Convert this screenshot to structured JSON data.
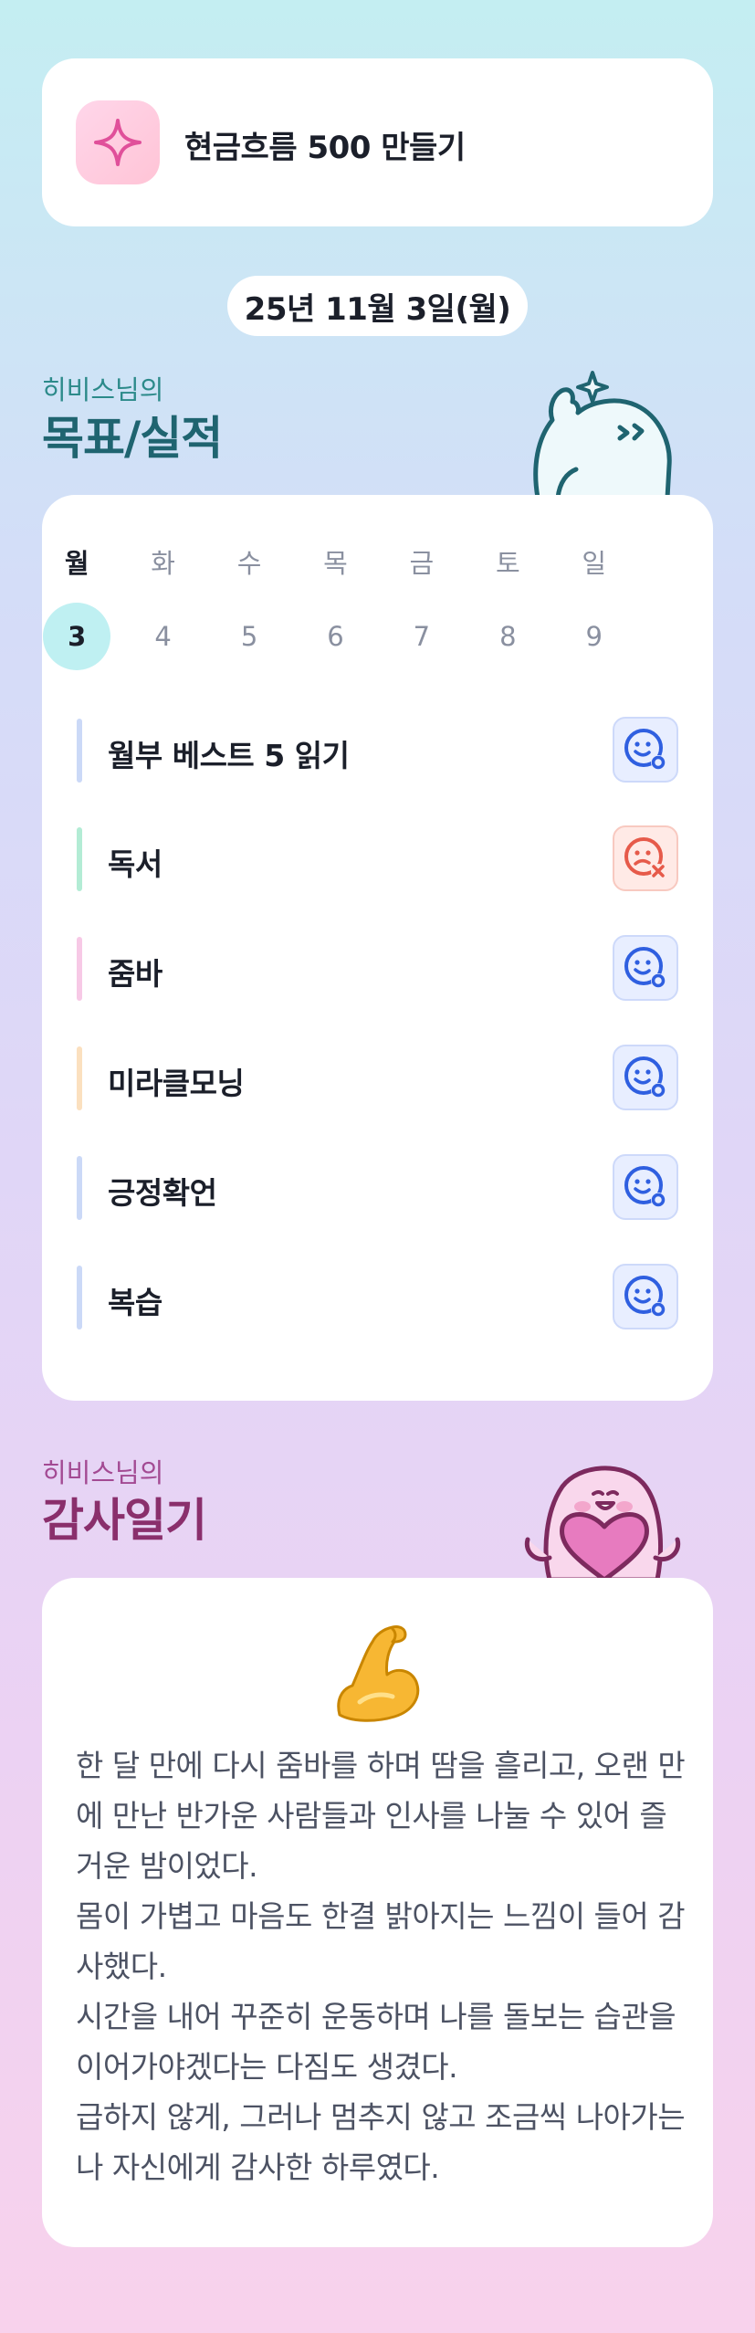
{
  "goal": {
    "title": "현금흐름 500 만들기",
    "icon": "sparkle-icon"
  },
  "date": "25년 11월 3일(월)",
  "goals_section": {
    "subtitle": "히비스님의",
    "title": "목표/실적"
  },
  "week": {
    "days": [
      "월",
      "화",
      "수",
      "목",
      "금",
      "토",
      "일"
    ],
    "dates": [
      "3",
      "4",
      "5",
      "6",
      "7",
      "8",
      "9"
    ],
    "selected_index": 0
  },
  "tasks": [
    {
      "label": "월부 베스트 5 읽기",
      "status": "done",
      "bar_color": "#cbd9f7"
    },
    {
      "label": "독서",
      "status": "failed",
      "bar_color": "#b3ecd5"
    },
    {
      "label": "줌바",
      "status": "done",
      "bar_color": "#f7c9e6"
    },
    {
      "label": "미라클모닝",
      "status": "done",
      "bar_color": "#fbe0bf"
    },
    {
      "label": "긍정확언",
      "status": "done",
      "bar_color": "#cbd9f7"
    },
    {
      "label": "복습",
      "status": "done",
      "bar_color": "#cbd9f7"
    }
  ],
  "gratitude_section": {
    "subtitle": "히비스님의",
    "title": "감사일기"
  },
  "diary": {
    "emoji": "flexed-biceps-icon",
    "lines": [
      "한 달 만에 다시 줌바를 하며 땀을 흘리고, 오랜 만에 만난 반가운 사람들과 인사를 나눌 수 있어 즐거운 밤이었다.",
      "몸이 가볍고 마음도 한결 밝아지는 느낌이 들어 감사했다.",
      "시간을 내어 꾸준히 운동하며 나를 돌보는 습관을 이어가야겠다는 다짐도 생겼다.",
      "급하지 않게, 그러나 멈추지 않고 조금씩 나아가는 나 자신에게 감사한 하루였다."
    ]
  },
  "colors": {
    "accent": "#2f5fe0",
    "fail": "#e65a4a"
  }
}
